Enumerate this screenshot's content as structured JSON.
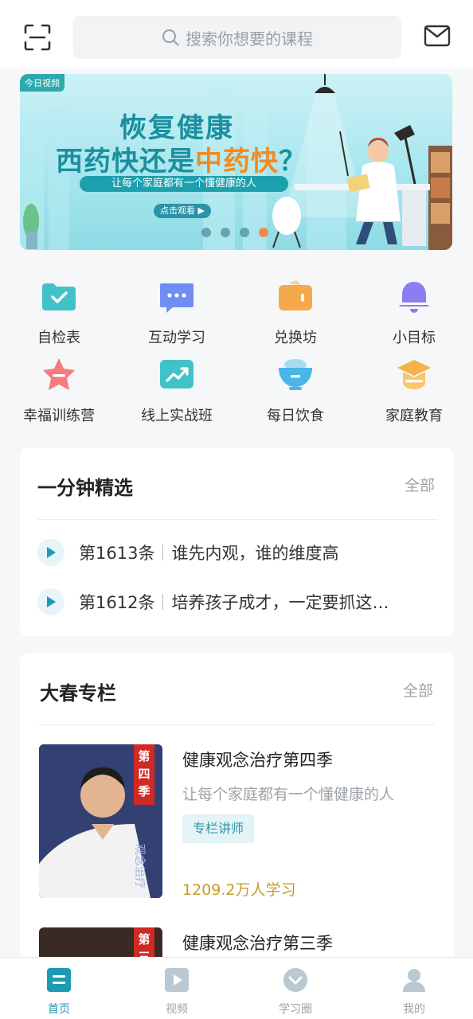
{
  "header": {
    "search_placeholder": "搜索你想要的课程"
  },
  "banner": {
    "tag": "今日视频",
    "title_line1": "恢复健康",
    "title_line2_a": "西药快还是",
    "title_line2_hl": "中药快",
    "title_line2_b": "？",
    "subtitle": "让每个家庭都有一个懂健康的人",
    "watch_label": "点击观看 ▶",
    "dots_total": 4,
    "dots_active": 4
  },
  "grid": [
    {
      "label": "自检表",
      "icon": "folder-check-icon",
      "color": "#41c2c9"
    },
    {
      "label": "互动学习",
      "icon": "chat-bubble-icon",
      "color": "#6f8df2"
    },
    {
      "label": "兑换坊",
      "icon": "wallet-icon",
      "color": "#f6a94a"
    },
    {
      "label": "小目标",
      "icon": "bell-icon",
      "color": "#8b7ef0"
    },
    {
      "label": "幸福训练营",
      "icon": "star-icon",
      "color": "#f47c7c"
    },
    {
      "label": "线上实战班",
      "icon": "trend-chart-icon",
      "color": "#41c2c9"
    },
    {
      "label": "每日饮食",
      "icon": "bowl-icon",
      "color": "#4ab6e8"
    },
    {
      "label": "家庭教育",
      "icon": "graduation-cap-icon",
      "color": "#f6b24a"
    }
  ],
  "minute_picks": {
    "title": "一分钟精选",
    "more": "全部",
    "items": [
      {
        "num": "第1613条",
        "text": "谁先内观，谁的维度高"
      },
      {
        "num": "第1612条",
        "text": "培养孩子成才，一定要抓这…"
      }
    ]
  },
  "column": {
    "title": "大春专栏",
    "more": "全部",
    "courses": [
      {
        "name": "健康观念治疗第四季",
        "desc": "让每个家庭都有一个懂健康的人",
        "badge": "专栏讲师",
        "count": "1209.2万人学习",
        "ribbon": "第四季"
      },
      {
        "name": "健康观念治疗第三季",
        "ribbon": "第三"
      }
    ]
  },
  "nav": [
    {
      "label": "首页",
      "icon": "home-icon",
      "active": true
    },
    {
      "label": "视频",
      "icon": "video-icon",
      "active": false
    },
    {
      "label": "学习圈",
      "icon": "circle-down-icon",
      "active": false
    },
    {
      "label": "我的",
      "icon": "user-icon",
      "active": false
    }
  ],
  "colors": {
    "accent": "#1f9ab4",
    "price": "#c79b26",
    "banner_highlight": "#f28a1e"
  }
}
